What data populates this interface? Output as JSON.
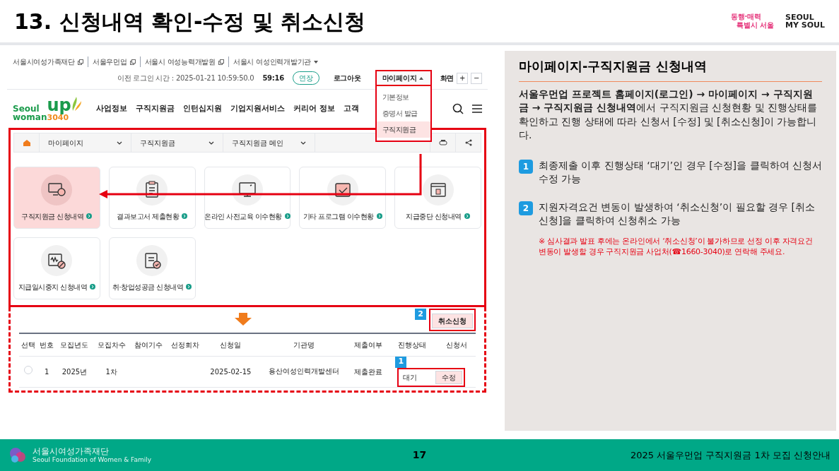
{
  "slide": {
    "title": "13. 신청내역 확인-수정 및 취소신청",
    "slogan": [
      "동행·매력",
      "특별시 서울"
    ],
    "brand": [
      "SEOUL",
      "MY SOUL"
    ]
  },
  "website": {
    "family_sites": [
      {
        "label": "서울시여성가족재단",
        "kind": "external"
      },
      {
        "label": "서울우먼업",
        "kind": "external"
      },
      {
        "label": "서울시 여성능력개발원",
        "kind": "external"
      },
      {
        "label": "서울시 여성인력개발기관",
        "kind": "dropdown"
      }
    ],
    "session": {
      "last_login": "이전 로그인 시간 : 2025-01-21 10:59:50.0",
      "timer": "59:16",
      "extend": "연장"
    },
    "logout": "로그아웃",
    "mypage": {
      "label": "마이페이지",
      "expanded": true,
      "menu": [
        {
          "label": "기본정보",
          "selected": false
        },
        {
          "label": "증명서 발급",
          "selected": false
        },
        {
          "label": "구직지원금",
          "selected": true
        }
      ]
    },
    "zoom": {
      "label": "화면",
      "buttons": [
        "+",
        "−"
      ]
    },
    "logo": {
      "lines": [
        "Seoul",
        "woman",
        "up",
        "3040"
      ]
    },
    "nav": [
      "사업정보",
      "구직지원금",
      "인턴십지원",
      "기업지원서비스",
      "커리어 정보",
      "고객"
    ],
    "breadcrumb": [
      "마이페이지",
      "구직지원금",
      "구직지원금 메인"
    ],
    "cards": [
      {
        "label": "구직지원금 신청내역",
        "highlighted": true
      },
      {
        "label": "결과보고서 제출현황",
        "highlighted": false
      },
      {
        "label": "온라인 사전교육 이수현황",
        "highlighted": false
      },
      {
        "label": "기타 프로그램 이수현황",
        "highlighted": false
      },
      {
        "label": "지급중단 신청내역",
        "highlighted": false
      },
      {
        "label": "지급일시중지 신청내역",
        "highlighted": false
      },
      {
        "label": "취·창업성공금 신청내역",
        "highlighted": false
      }
    ],
    "cancel_button": {
      "label": "취소신청",
      "marker": "2"
    },
    "table": {
      "columns": [
        "선택",
        "번호",
        "모집년도",
        "모집차수",
        "참여기수",
        "선정회차",
        "신청일",
        "기관명",
        "제출여부",
        "진행상태",
        "신청서"
      ],
      "rows": [
        {
          "selected": false,
          "number": "1",
          "year": "2025년",
          "round": "1차",
          "date": "2025-02-15",
          "agency": "용산여성인력개발센터",
          "submitted": "제출완료",
          "status": "대기",
          "edit": "수정",
          "marker": "1"
        }
      ]
    }
  },
  "panel": {
    "title": "마이페이지-구직지원금 신청내역",
    "intro": "**서울우먼업 프로젝트 홈페이지(로그인) → 마이페이지 → 구직지원금 → 구직지원금 신청내역**에서 구직지원금 신청현황 및 진행상태를 확인하고 진행 상태에 따라 신청서 [수정] 및 [취소신청]이 가능합니다.",
    "steps": [
      {
        "marker": "1",
        "text": "최종제출 이후 진행상태 ‘대기’인 경우 [수정]을 클릭하여 신청서 수정 가능"
      },
      {
        "marker": "2",
        "text": "지원자격요건 변동이 발생하여 ‘취소신청’이 필요할 경우 [취소신청]을 클릭하여 신청취소 가능"
      }
    ],
    "note": "※ 심사결과 발표 후에는 온라인에서 ‘취소신청’이 불가하므로 선정 이후 자격요건 변동이 발생할 경우 구직지원금 사업처(☎1660-3040)로 연락해 주세요."
  },
  "footer": {
    "org": "서울시여성가족재단",
    "org_en": "Seoul Foundation of Women & Family",
    "page": "17",
    "caption": "2025 서울우먼업 구직지원금 1차 모집 신청안내"
  }
}
